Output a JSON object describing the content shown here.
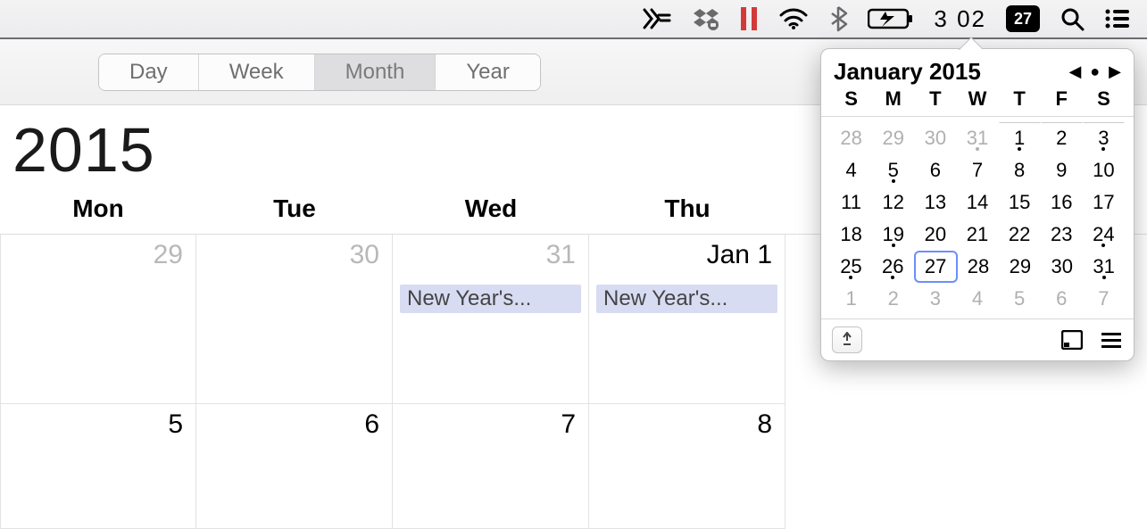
{
  "menubar": {
    "clock": "3 02",
    "date_badge": "27"
  },
  "toolbar": {
    "views": {
      "day": "Day",
      "week": "Week",
      "month": "Month",
      "year": "Year"
    },
    "active": "Month"
  },
  "calendar": {
    "year_title": "2015",
    "weekdays": [
      "Mon",
      "Tue",
      "Wed",
      "Thu"
    ],
    "row1": [
      {
        "label": "29",
        "prev": true,
        "event": null
      },
      {
        "label": "30",
        "prev": true,
        "event": null
      },
      {
        "label": "31",
        "prev": true,
        "event": "New Year's..."
      },
      {
        "label": "Jan 1",
        "prev": false,
        "event": "New Year's..."
      }
    ],
    "row2": [
      {
        "label": "5",
        "prev": false
      },
      {
        "label": "6",
        "prev": false
      },
      {
        "label": "7",
        "prev": false
      },
      {
        "label": "8",
        "prev": false
      }
    ]
  },
  "popover": {
    "title": "January 2015",
    "dow": [
      "S",
      "M",
      "T",
      "W",
      "T",
      "F",
      "S"
    ],
    "weeks": [
      [
        {
          "n": "28",
          "other": true,
          "dot": false
        },
        {
          "n": "29",
          "other": true,
          "dot": false
        },
        {
          "n": "30",
          "other": true,
          "dot": false
        },
        {
          "n": "31",
          "other": true,
          "dot": true
        },
        {
          "n": "1",
          "other": false,
          "dot": true
        },
        {
          "n": "2",
          "other": false,
          "dot": false
        },
        {
          "n": "3",
          "other": false,
          "dot": true
        }
      ],
      [
        {
          "n": "4",
          "other": false,
          "dot": false
        },
        {
          "n": "5",
          "other": false,
          "dot": true
        },
        {
          "n": "6",
          "other": false,
          "dot": false
        },
        {
          "n": "7",
          "other": false,
          "dot": false
        },
        {
          "n": "8",
          "other": false,
          "dot": false
        },
        {
          "n": "9",
          "other": false,
          "dot": false
        },
        {
          "n": "10",
          "other": false,
          "dot": false
        }
      ],
      [
        {
          "n": "11",
          "other": false,
          "dot": false
        },
        {
          "n": "12",
          "other": false,
          "dot": false
        },
        {
          "n": "13",
          "other": false,
          "dot": false
        },
        {
          "n": "14",
          "other": false,
          "dot": false
        },
        {
          "n": "15",
          "other": false,
          "dot": false
        },
        {
          "n": "16",
          "other": false,
          "dot": false
        },
        {
          "n": "17",
          "other": false,
          "dot": false
        }
      ],
      [
        {
          "n": "18",
          "other": false,
          "dot": false
        },
        {
          "n": "19",
          "other": false,
          "dot": true
        },
        {
          "n": "20",
          "other": false,
          "dot": false
        },
        {
          "n": "21",
          "other": false,
          "dot": false
        },
        {
          "n": "22",
          "other": false,
          "dot": false
        },
        {
          "n": "23",
          "other": false,
          "dot": false
        },
        {
          "n": "24",
          "other": false,
          "dot": true
        }
      ],
      [
        {
          "n": "25",
          "other": false,
          "dot": true
        },
        {
          "n": "26",
          "other": false,
          "dot": true
        },
        {
          "n": "27",
          "other": false,
          "dot": false,
          "today": true
        },
        {
          "n": "28",
          "other": false,
          "dot": false
        },
        {
          "n": "29",
          "other": false,
          "dot": false
        },
        {
          "n": "30",
          "other": false,
          "dot": false
        },
        {
          "n": "31",
          "other": false,
          "dot": true
        }
      ],
      [
        {
          "n": "1",
          "other": true,
          "dot": false
        },
        {
          "n": "2",
          "other": true,
          "dot": false
        },
        {
          "n": "3",
          "other": true,
          "dot": false
        },
        {
          "n": "4",
          "other": true,
          "dot": false
        },
        {
          "n": "5",
          "other": true,
          "dot": false
        },
        {
          "n": "6",
          "other": true,
          "dot": false
        },
        {
          "n": "7",
          "other": true,
          "dot": false
        }
      ]
    ]
  }
}
